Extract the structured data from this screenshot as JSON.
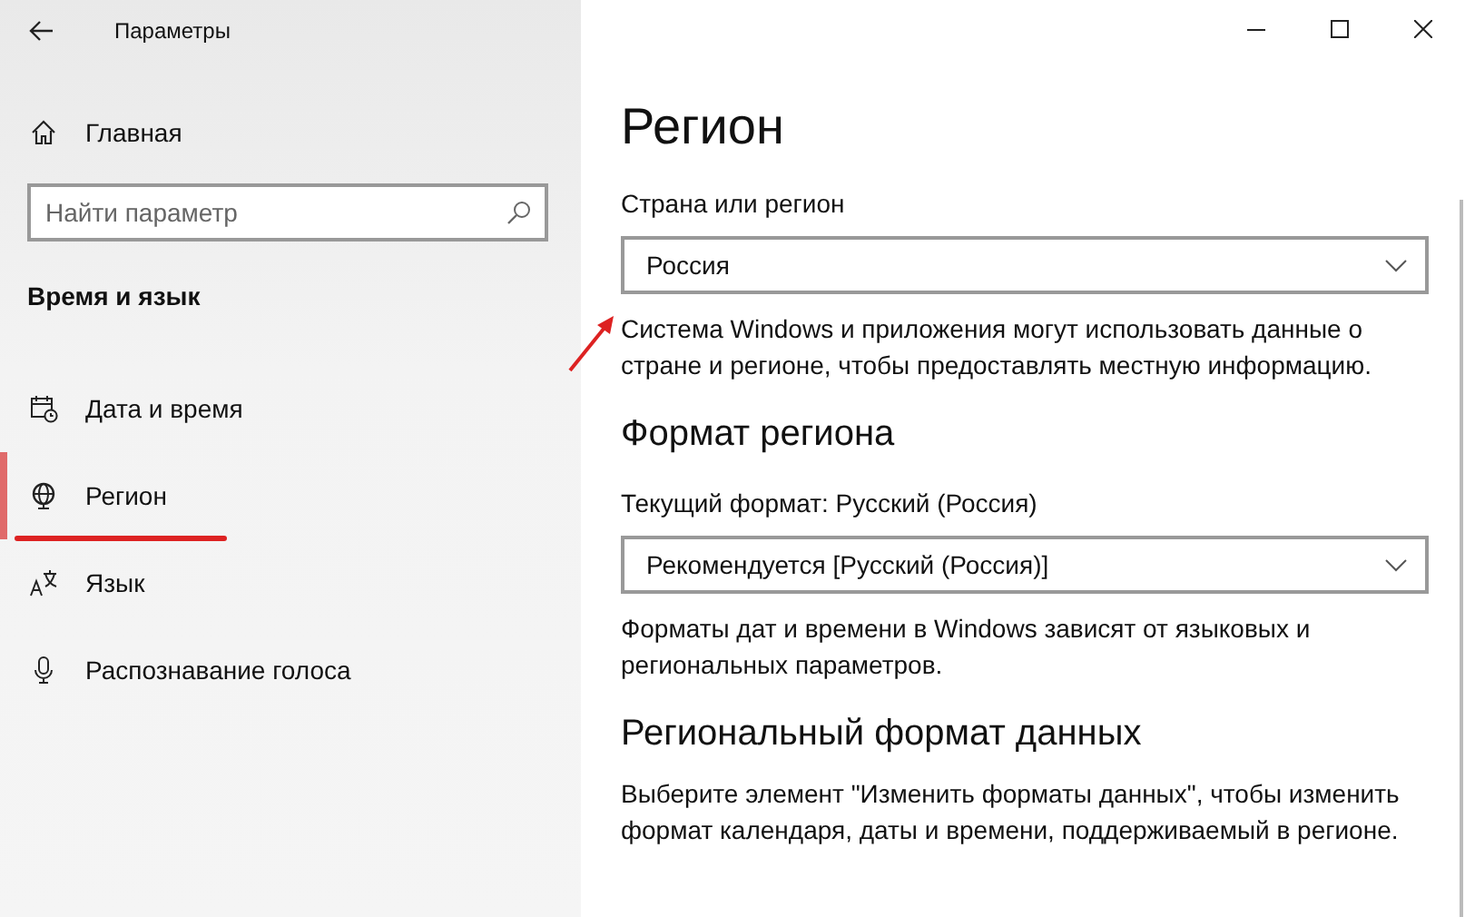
{
  "window": {
    "title": "Параметры"
  },
  "sidebar": {
    "home": "Главная",
    "search": {
      "placeholder": "Найти параметр"
    },
    "section": "Время и язык",
    "items": [
      {
        "label": "Дата и время",
        "selected": false
      },
      {
        "label": "Регион",
        "selected": true
      },
      {
        "label": "Язык",
        "selected": false
      },
      {
        "label": "Распознавание голоса",
        "selected": false
      }
    ]
  },
  "content": {
    "title": "Регион",
    "sections": [
      {
        "kind": "field",
        "label": "Страна или регион",
        "value": "Россия",
        "description": "Система Windows и приложения могут использовать данные о стране и регионе, чтобы предоставлять местную информацию."
      },
      {
        "kind": "field",
        "heading": "Формат региона",
        "label": "Текущий формат: Русский (Россия)",
        "value": "Рекомендуется [Русский (Россия)]",
        "description": "Форматы дат и времени в Windows зависят от языковых и региональных параметров."
      },
      {
        "kind": "text",
        "heading": "Региональный формат данных",
        "description": "Выберите элемент \"Изменить форматы данных\", чтобы изменить формат календаря, даты и времени, поддерживаемый в регионе."
      }
    ]
  }
}
